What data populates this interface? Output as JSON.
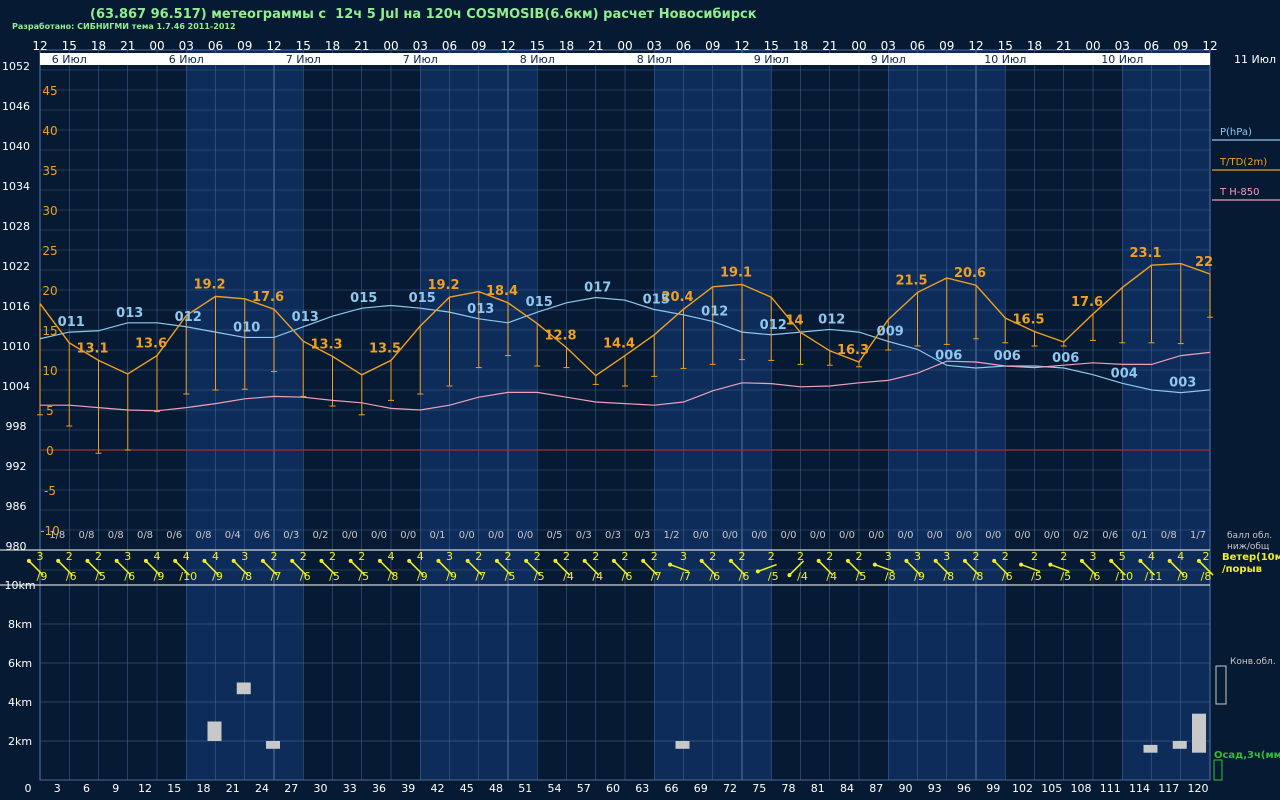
{
  "header": {
    "title": "(63.867 96.517) метеограммы с  12ч 5 Jul на 120ч COSMOSIB(6.6км) расчет Новосибирск",
    "credit": "Разработано: СИБНИГМИ тема 1.7.46 2011-2012"
  },
  "colors": {
    "background": "#071a33",
    "day_band": "#0d2c5a",
    "grid": "#4a6a96",
    "pressure": "#8fc8ee",
    "temperature": "#f0a020",
    "t850": "#f0a0b8",
    "wind": "#f0f020",
    "freeze_line": "#a03030",
    "cloud_bar": "#c8c8c8",
    "precip": "#30c030"
  },
  "chart_data": [
    {
      "type": "line",
      "name": "meteogram",
      "top_hours": [
        "12",
        "15",
        "18",
        "21",
        "00",
        "03",
        "06",
        "09",
        "12",
        "15",
        "18",
        "21",
        "00",
        "03",
        "06",
        "09",
        "12",
        "15",
        "18",
        "21",
        "00",
        "03",
        "06",
        "09",
        "12",
        "15",
        "18",
        "21",
        "00",
        "03",
        "06",
        "09",
        "12",
        "15",
        "18",
        "21",
        "00",
        "03",
        "06",
        "09",
        "12"
      ],
      "dates": [
        "6 Июл",
        "6 Июл",
        "7 Июл",
        "7 Июл",
        "8 Июл",
        "8 Июл",
        "9 Июл",
        "9 Июл",
        "10 Июл",
        "10 Июл"
      ],
      "next_date": "11 Июл",
      "pressure_ticks": [
        "1052",
        "1046",
        "1040",
        "1034",
        "1028",
        "1022",
        "1016",
        "1010",
        "1004",
        "998",
        "992",
        "986",
        "980"
      ],
      "temp_ticks": [
        "45",
        "40",
        "35",
        "30",
        "25",
        "20",
        "15",
        "10",
        "5",
        "0",
        "-5",
        "-10"
      ],
      "legend": [
        "P(hPa)",
        "T/TD(2m)",
        "T H-850"
      ],
      "x": [
        0,
        3,
        6,
        9,
        12,
        15,
        18,
        21,
        24,
        27,
        30,
        33,
        36,
        39,
        42,
        45,
        48,
        51,
        54,
        57,
        60,
        63,
        66,
        69,
        72,
        75,
        78,
        81,
        84,
        87,
        90,
        93,
        96,
        99,
        102,
        105,
        108,
        111,
        114,
        117,
        120
      ],
      "temperature": [
        18.3,
        13.4,
        11.2,
        9.5,
        11.8,
        16.8,
        19.2,
        18.9,
        17.6,
        13.6,
        11.7,
        9.4,
        11.2,
        15.5,
        19.1,
        19.8,
        18.4,
        15.8,
        12.8,
        9.3,
        11.8,
        14.4,
        17.6,
        20.4,
        20.7,
        19.1,
        14.7,
        12.4,
        11.0,
        16.3,
        19.7,
        21.5,
        20.6,
        16.5,
        14.8,
        13.5,
        17.0,
        20.3,
        23.1,
        23.3,
        22.0
      ],
      "dewpoint_drops": [
        4.4,
        3.0,
        -0.4,
        0.0,
        4.8,
        7.0,
        7.5,
        7.6,
        9.8,
        6.7,
        5.5,
        4.4,
        6.2,
        7.0,
        8.0,
        10.3,
        11.8,
        10.5,
        10.3,
        8.2,
        8.0,
        9.2,
        10.2,
        10.7,
        11.3,
        11.2,
        10.7,
        10.6,
        10.4,
        12.5,
        13.0,
        13.2,
        13.9,
        13.4,
        13.0,
        13.0,
        13.7,
        13.4,
        13.4,
        13.3,
        16.6
      ],
      "pressure": [
        1011.0,
        1012.0,
        1012.2,
        1013.4,
        1013.4,
        1012.8,
        1012.0,
        1011.2,
        1011.2,
        1012.8,
        1014.4,
        1015.6,
        1016.0,
        1015.6,
        1015.0,
        1014.0,
        1013.4,
        1015.0,
        1016.4,
        1017.2,
        1016.8,
        1015.4,
        1014.6,
        1013.6,
        1012.0,
        1011.6,
        1012.0,
        1012.4,
        1012.0,
        1010.6,
        1009.4,
        1007.0,
        1006.6,
        1006.9,
        1006.9,
        1006.6,
        1005.6,
        1004.3,
        1003.3,
        1002.9,
        1003.3
      ],
      "t850": [
        5.6,
        5.6,
        5.3,
        5.0,
        4.9,
        5.3,
        5.8,
        6.4,
        6.7,
        6.6,
        6.2,
        5.9,
        5.2,
        5.0,
        5.6,
        6.6,
        7.2,
        7.2,
        6.6,
        6.0,
        5.8,
        5.6,
        6.0,
        7.4,
        8.4,
        8.3,
        7.9,
        8.0,
        8.4,
        8.7,
        9.6,
        11.1,
        11.0,
        10.5,
        10.3,
        10.6,
        10.9,
        10.7,
        10.7,
        11.8,
        12.2
      ],
      "temp_labels": [
        {
          "i": 2,
          "t": "13.1"
        },
        {
          "i": 4,
          "t": "13.6"
        },
        {
          "i": 6,
          "t": "19.2"
        },
        {
          "i": 8,
          "t": "17.6"
        },
        {
          "i": 10,
          "t": "13.3"
        },
        {
          "i": 12,
          "t": "13.5"
        },
        {
          "i": 14,
          "t": "19.2"
        },
        {
          "i": 16,
          "t": "18.4"
        },
        {
          "i": 18,
          "t": "12.8"
        },
        {
          "i": 20,
          "t": "14.4"
        },
        {
          "i": 22,
          "t": "20.4"
        },
        {
          "i": 24,
          "t": "19.1"
        },
        {
          "i": 26,
          "t": "14"
        },
        {
          "i": 28,
          "t": "16.3"
        },
        {
          "i": 30,
          "t": "21.5"
        },
        {
          "i": 32,
          "t": "20.6"
        },
        {
          "i": 34,
          "t": "16.5"
        },
        {
          "i": 36,
          "t": "17.6"
        },
        {
          "i": 38,
          "t": "23.1"
        },
        {
          "i": 40,
          "t": "22"
        }
      ],
      "pressure_labels": [
        {
          "i": 1,
          "t": "011"
        },
        {
          "i": 3,
          "t": "013"
        },
        {
          "i": 5,
          "t": "012"
        },
        {
          "i": 7,
          "t": "010"
        },
        {
          "i": 9,
          "t": "013"
        },
        {
          "i": 11,
          "t": "015"
        },
        {
          "i": 13,
          "t": "015"
        },
        {
          "i": 15,
          "t": "013"
        },
        {
          "i": 17,
          "t": "015"
        },
        {
          "i": 19,
          "t": "017"
        },
        {
          "i": 21,
          "t": "015"
        },
        {
          "i": 23,
          "t": "012"
        },
        {
          "i": 25,
          "t": "012"
        },
        {
          "i": 27,
          "t": "012"
        },
        {
          "i": 29,
          "t": "009"
        },
        {
          "i": 31,
          "t": "006"
        },
        {
          "i": 33,
          "t": "006"
        },
        {
          "i": 35,
          "t": "006"
        },
        {
          "i": 37,
          "t": "004"
        },
        {
          "i": 39,
          "t": "003"
        }
      ],
      "cloud_cover": [
        "1/8",
        "0/8",
        "0/8",
        "0/8",
        "0/6",
        "0/8",
        "0/4",
        "0/6",
        "0/3",
        "0/2",
        "0/0",
        "0/0",
        "0/0",
        "0/1",
        "0/0",
        "0/0",
        "0/0",
        "0/5",
        "0/3",
        "0/3",
        "0/3",
        "1/2",
        "0/0",
        "0/0",
        "0/0",
        "0/0",
        "0/0",
        "0/0",
        "0/0",
        "0/0",
        "0/0",
        "0/0",
        "0/0",
        "0/0",
        "0/0",
        "0/2",
        "0/6",
        "0/1",
        "0/8",
        "1/7"
      ],
      "cloud_legend": [
        "балл обл.",
        "ниж/общ"
      ],
      "wind_speed": [
        "3",
        "2",
        "2",
        "3",
        "4",
        "4",
        "4",
        "3",
        "2",
        "2",
        "2",
        "2",
        "4",
        "4",
        "3",
        "2",
        "2",
        "2",
        "2",
        "2",
        "2",
        "2",
        "3",
        "2",
        "2",
        "2",
        "2",
        "2",
        "2",
        "3",
        "3",
        "3",
        "2",
        "2",
        "2",
        "2",
        "3",
        "5",
        "4",
        "4",
        "2"
      ],
      "wind_gust": [
        "/9",
        "/6",
        "/5",
        "/6",
        "/9",
        "/10",
        "/9",
        "/8",
        "/7",
        "/6",
        "/5",
        "/5",
        "/8",
        "/9",
        "/9",
        "/7",
        "/5",
        "/5",
        "/4",
        "/4",
        "/6",
        "/7",
        "/7",
        "/6",
        "/6",
        "/5",
        "/4",
        "/4",
        "/5",
        "/8",
        "/9",
        "/8",
        "/8",
        "/6",
        "/5",
        "/5",
        "/6",
        "/10",
        "/11",
        "/9",
        "/8"
      ],
      "wind_dir": [
        "nw",
        "nw",
        "nw",
        "nw",
        "nw",
        "nw",
        "nw",
        "nw",
        "nw",
        "nw",
        "nw",
        "nw",
        "nw",
        "nw",
        "nw",
        "nw",
        "nw",
        "nw",
        "nw",
        "nw",
        "nw",
        "nw",
        "wnw",
        "w",
        "w",
        "wsw",
        "sw",
        "nw",
        "w",
        "wnw",
        "w",
        "w",
        "w",
        "w",
        "wnw",
        "wnw",
        "nw",
        "nw",
        "nw",
        "nw",
        "nw"
      ],
      "wind_legend": [
        "Ветер(10м",
        "/порыв"
      ]
    },
    {
      "type": "bar",
      "name": "clouds-and-precip",
      "height_ticks": [
        "10km",
        "8km",
        "6km",
        "4km",
        "2km"
      ],
      "x_ticks": [
        "0",
        "3",
        "6",
        "9",
        "12",
        "15",
        "18",
        "21",
        "24",
        "27",
        "30",
        "33",
        "36",
        "39",
        "42",
        "45",
        "48",
        "51",
        "54",
        "57",
        "60",
        "63",
        "66",
        "69",
        "72",
        "75",
        "78",
        "81",
        "84",
        "87",
        "90",
        "93",
        "96",
        "99",
        "102",
        "105",
        "108",
        "111",
        "114",
        "117",
        "120"
      ],
      "convective_clouds_km": [
        {
          "h": 18,
          "low": 2.0,
          "high": 3.0
        },
        {
          "h": 21,
          "low": 4.4,
          "high": 5.0
        },
        {
          "h": 24,
          "low": 1.6,
          "high": 2.0
        },
        {
          "h": 66,
          "low": 1.6,
          "high": 2.0
        },
        {
          "h": 114,
          "low": 1.4,
          "high": 1.8
        },
        {
          "h": 117,
          "low": 1.6,
          "high": 2.0
        },
        {
          "h": 120,
          "low": 1.4,
          "high": 3.4
        }
      ],
      "precip_legend": "Осад,3ч(мм)",
      "conv_legend": "Конв.обл."
    }
  ]
}
